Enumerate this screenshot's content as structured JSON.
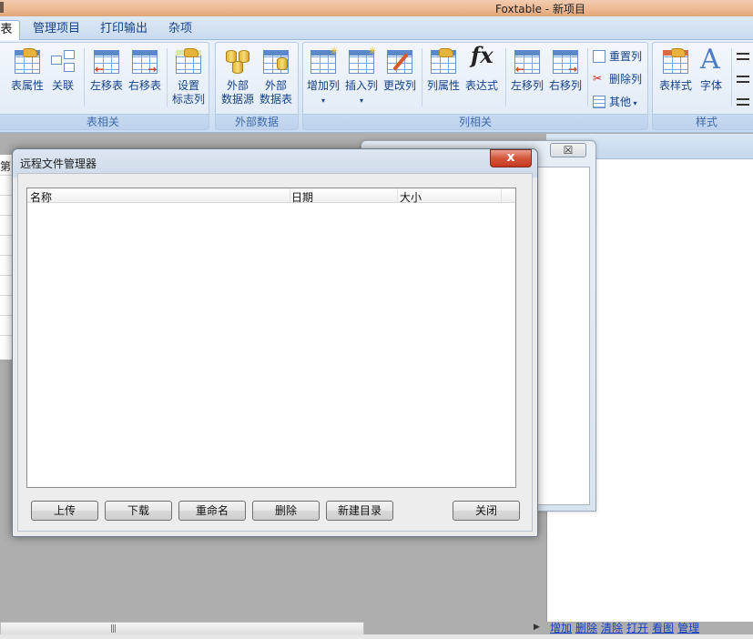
{
  "window": {
    "title": "Foxtable - 新项目"
  },
  "tabs": [
    {
      "label": "表",
      "active": true
    },
    {
      "label": "管理项目",
      "active": false
    },
    {
      "label": "打印输出",
      "active": false
    },
    {
      "label": "杂项",
      "active": false
    }
  ],
  "ribbon": {
    "group_table": {
      "label": "表相关",
      "table_props": "表属性",
      "relations": "关联",
      "move_left": "左移表",
      "move_right": "右移表",
      "flag_col_line1": "设置",
      "flag_col_line2": "标志列"
    },
    "group_external": {
      "label": "外部数据",
      "ext_source_line1": "外部",
      "ext_source_line2": "数据源",
      "ext_table_line1": "外部",
      "ext_table_line2": "数据表"
    },
    "group_columns": {
      "label": "列相关",
      "add_col": "增加列",
      "insert_col": "插入列",
      "change_col": "更改列",
      "col_props": "列属性",
      "expression": "表达式",
      "col_left": "左移列",
      "col_right": "右移列",
      "reset_col": "重置列",
      "delete_col": "删除列",
      "other": "其他"
    },
    "group_style": {
      "label": "样式",
      "table_style": "表样式",
      "font": "字体"
    }
  },
  "background": {
    "left_label": "第",
    "bg_window_close": "☒",
    "links": [
      "增加",
      "删除",
      "清除",
      "打开",
      "看图",
      "管理"
    ]
  },
  "dialog": {
    "title": "远程文件管理器",
    "close_glyph": "x",
    "columns": [
      "名称",
      "日期",
      "大小"
    ],
    "buttons": {
      "upload": "上传",
      "download": "下载",
      "rename": "重命名",
      "delete": "删除",
      "new_folder": "新建目录",
      "close": "关闭"
    }
  }
}
